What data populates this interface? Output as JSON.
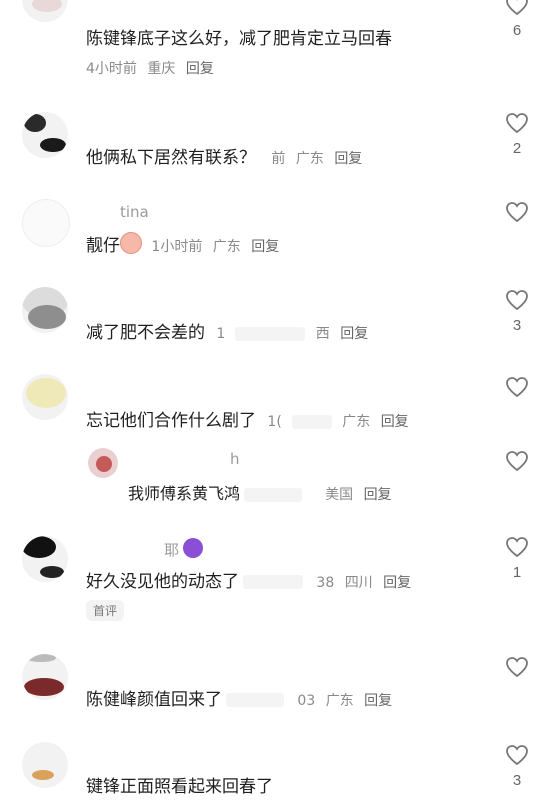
{
  "comments": [
    {
      "name": "",
      "text": "陈键锋底子这么好，减了肥肯定立马回春",
      "time": "4小时前",
      "location": "重庆",
      "reply": "回复",
      "likes": "6"
    },
    {
      "name": "",
      "text": "他俩私下居然有联系？",
      "time": "前",
      "location": "广东",
      "reply": "回复",
      "likes": "2"
    },
    {
      "name": "tina",
      "text": "靓仔",
      "time": "1小时前",
      "location": "广东",
      "reply": "回复",
      "likes": ""
    },
    {
      "name": "",
      "text": "减了肥不会差的",
      "time": "1",
      "location": "西",
      "reply": "回复",
      "likes": "3"
    },
    {
      "name": "",
      "text": "忘记他们合作什么剧了",
      "time": "1(",
      "location": "广东",
      "reply": "回复",
      "likes": ""
    },
    {
      "name": "h",
      "text": "我师傅系黄飞鸿",
      "time": "",
      "location": "美国",
      "reply": "回复",
      "likes": ""
    },
    {
      "name": "耶",
      "text": "好久没见他的动态了",
      "time": "38",
      "location": "四川",
      "reply": "回复",
      "likes": "1",
      "badge": "首评"
    },
    {
      "name": "",
      "text": "陈健峰颜值回来了",
      "time": "03",
      "location": "广东",
      "reply": "回复",
      "likes": ""
    },
    {
      "name": "",
      "text": "键锋正面照看起来回春了",
      "time": "",
      "location": "",
      "reply": "",
      "likes": "3"
    }
  ],
  "icons": {
    "like": "heart-outline-icon",
    "pig_emoji": "pig-face-emoji-icon",
    "devil_emoji": "smiling-devil-emoji-icon"
  },
  "colors": {
    "text": "#1f1f1f",
    "meta": "#8a8a8a",
    "name": "#9a9a9a"
  }
}
